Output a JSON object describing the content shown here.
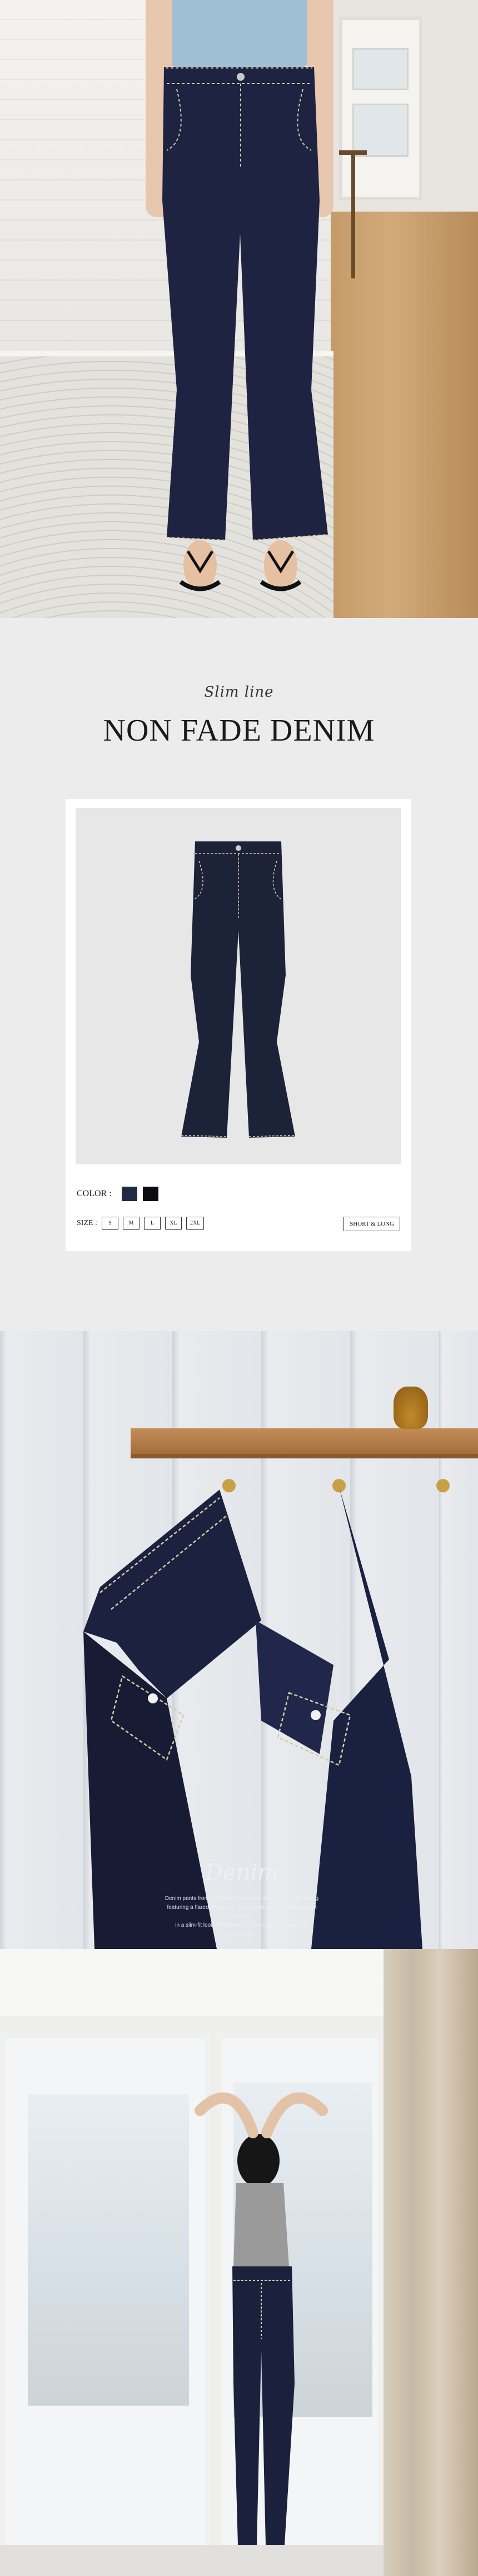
{
  "product": {
    "script_title": "Slim line",
    "title": "NON FADE DENIM"
  },
  "options": {
    "color_label": "COLOR :",
    "colors": [
      "#1f2a44",
      "#0d0d0f"
    ],
    "size_label": "SIZE :",
    "sizes": [
      "S",
      "M",
      "L",
      "XL",
      "2XL"
    ],
    "length_label": "SHORT & LONG"
  },
  "caption": {
    "word": "Denim",
    "lines": [
      "Denim pants from collection. the colors that go well with spring",
      "featuring a flared silhouette. Comfortable texture and elegant design",
      "in a slim-fit look reinterpreted in a design that matches everywhere."
    ]
  }
}
